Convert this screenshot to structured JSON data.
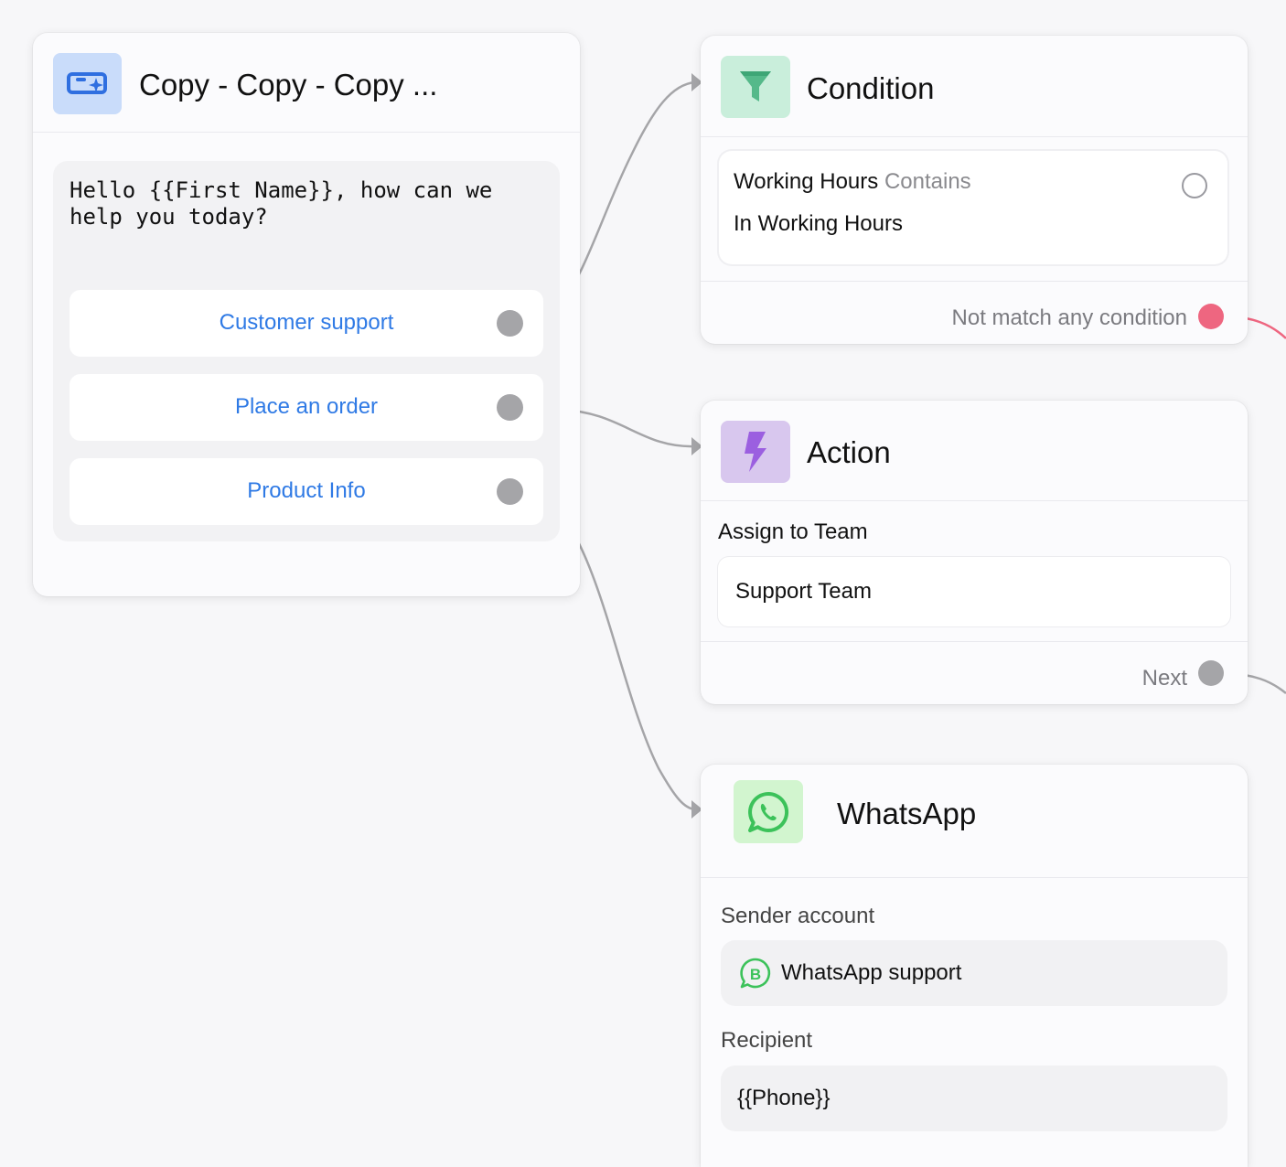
{
  "colors": {
    "canvas_bg": "#f7f7f9",
    "link_blue": "#2f7ae5",
    "edge_grey": "#a5a5a8",
    "edge_red": "#ee6680",
    "message_icon_bg": "#c9dcfa",
    "condition_icon_bg": "#c9eedb",
    "action_icon_bg": "#d8c7ee",
    "whatsapp_icon_bg": "#d2f5cf"
  },
  "message_node": {
    "icon": "chat-sparkle-icon",
    "title": "Copy - Copy - Copy ...",
    "text": "Hello {{First Name}}, how can we help you today?",
    "quick_replies": [
      {
        "label": "Customer support"
      },
      {
        "label": "Place an order"
      },
      {
        "label": "Product Info"
      }
    ]
  },
  "condition_node": {
    "icon": "filter-funnel-icon",
    "title": "Condition",
    "rule": {
      "field": "Working Hours",
      "operator": "Contains",
      "value": "In Working Hours"
    },
    "fallback_label": "Not match any condition"
  },
  "action_node": {
    "icon": "lightning-bolt-icon",
    "title": "Action",
    "action_label": "Assign to Team",
    "action_value": "Support Team",
    "next_label": "Next"
  },
  "whatsapp_node": {
    "icon": "whatsapp-icon",
    "title": "WhatsApp",
    "sender_label": "Sender account",
    "sender_value": "WhatsApp support",
    "sender_badge_icon": "whatsapp-business-icon",
    "recipient_label": "Recipient",
    "recipient_value": "{{Phone}}"
  }
}
